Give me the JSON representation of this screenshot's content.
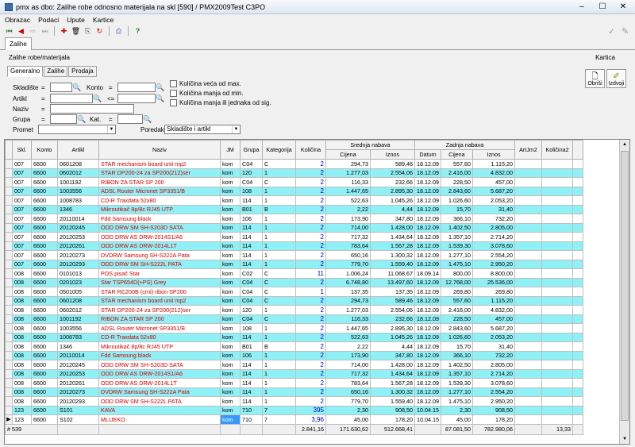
{
  "window": {
    "title": "pmx as dbo: Zalihe robe odnosno materijala na skl [590] / PMX2009Test C3PO",
    "minimize": "‒",
    "maximize": "☐",
    "close": "✕"
  },
  "menu": [
    "Obrazac",
    "Podaci",
    "Upute",
    "Kartice"
  ],
  "doc_tab": "Zalihe",
  "panel": {
    "title": "Zalihe robe/materijala",
    "kartica": "Kartica"
  },
  "subtabs": [
    "Generalno",
    "Zalihe",
    "Prodaja"
  ],
  "filters": {
    "skladiste": {
      "label": "Skladište",
      "op": "="
    },
    "konto": {
      "label": "Konto",
      "op": "="
    },
    "artikl": {
      "label": "Artikl",
      "op1": "=",
      "op2": "<="
    },
    "naziv": {
      "label": "Naziv",
      "op": "="
    },
    "grupa": {
      "label": "Grupa",
      "op": "="
    },
    "kat": {
      "label": "Kat.",
      "op": "="
    },
    "promet": {
      "label": "Promet",
      "value": ""
    },
    "poredak": {
      "label": "Poredak",
      "value": "Skladište i artikl"
    },
    "checks": [
      "Količina veća od max.",
      "Količina manja od min.",
      "Količina manja ili jednaka od sig."
    ],
    "obrisi": "Obriši",
    "izdvoji": "Izdvoji"
  },
  "grid": {
    "headers": {
      "skl": "Skl.",
      "konto": "Konto",
      "artikl": "Artikl",
      "naziv": "Naziv",
      "jm": "JM",
      "grupa": "Grupa",
      "kategorija": "Kategorija",
      "kolicina": "Količina",
      "srednja": "Srednja nabava",
      "cijena": "Cijena",
      "iznos": "Iznos",
      "zadnja": "Zadnja nabava",
      "datum": "Datum",
      "cijena2": "Cijena",
      "iznos2": "Iznos",
      "artjm2": "ArtJm2",
      "kolicina2": "Količina2"
    },
    "rows": [
      [
        "007",
        "6600",
        "0601208",
        "STAR mechanism board unit mp2",
        "kom",
        "C04",
        "C",
        "2",
        "294,73",
        "589,46",
        "18.12.09",
        "557,60",
        "1.115,20",
        "",
        ""
      ],
      [
        "007",
        "6600",
        "0602012",
        "STAR DP200-24 za SP200(212)ser",
        "kom",
        "120",
        "1",
        "2",
        "1.277,03",
        "2.554,06",
        "18.12.09",
        "2.416,00",
        "4.832,00",
        "",
        ""
      ],
      [
        "007",
        "6600",
        "1001192",
        "RIBON ZA STAR SP 200",
        "kom",
        "C04",
        "C",
        "2",
        "116,33",
        "232,66",
        "18.12.09",
        "228,50",
        "457,00",
        "",
        ""
      ],
      [
        "007",
        "6600",
        "1003556",
        "ADSL Router Micronet SP3351/B",
        "kom",
        "108",
        "1",
        "2",
        "1.447,65",
        "2.895,30",
        "18.12.09",
        "2.843,60",
        "5.687,20",
        "",
        ""
      ],
      [
        "007",
        "6600",
        "1008783",
        "CD-R Traxdata 52x80",
        "kom",
        "114",
        "1",
        "2",
        "522,63",
        "1.045,26",
        "18.12.09",
        "1.026,60",
        "2.053,20",
        "",
        ""
      ],
      [
        "007",
        "6600",
        "1346",
        "Mikroutikač 8p/8c RJ45 UTP",
        "kom",
        "B01",
        "B",
        "2",
        "2,22",
        "4,44",
        "18.12.09",
        "15,70",
        "31,40",
        "",
        ""
      ],
      [
        "007",
        "6600",
        "20110014",
        "Fdd Samsung black",
        "kom",
        "106",
        "1",
        "2",
        "173,90",
        "347,80",
        "18.12.09",
        "366,10",
        "732,20",
        "",
        ""
      ],
      [
        "007",
        "6600",
        "20120245",
        "ODD DRW SM SH-S203D SATA",
        "kom",
        "114",
        "1",
        "2",
        "714,00",
        "1.428,00",
        "18.12.09",
        "1.402,50",
        "2.805,00",
        "",
        ""
      ],
      [
        "007",
        "6600",
        "20120253",
        "ODD DRW AS DRW-2014S1/A6",
        "kom",
        "114",
        "1",
        "2",
        "717,32",
        "1.434,64",
        "18.12.09",
        "1.357,10",
        "2.714,20",
        "",
        ""
      ],
      [
        "007",
        "6600",
        "20120261",
        "ODD DRW AS DRW-2014L1T",
        "kom",
        "114",
        "1",
        "2",
        "783,64",
        "1.567,28",
        "18.12.09",
        "1.539,30",
        "3.078,60",
        "",
        ""
      ],
      [
        "007",
        "6600",
        "20120273",
        "DVDRW Samsung SH-S222A Pata",
        "kom",
        "114",
        "1",
        "2",
        "650,16",
        "1.300,32",
        "18.12.09",
        "1.277,10",
        "2.554,20",
        "",
        ""
      ],
      [
        "007",
        "6600",
        "20120293",
        "ODD DRW SM SH-S222L PATA",
        "kom",
        "114",
        "1",
        "2",
        "779,70",
        "1.559,40",
        "18.12.09",
        "1.475,10",
        "2.950,20",
        "",
        ""
      ],
      [
        "008",
        "6600",
        "0101013",
        "POS pisač Star",
        "kom",
        "C02",
        "C",
        "11",
        "1.006,24",
        "11.068,67",
        "18.09.14",
        "800,00",
        "8.800,00",
        "",
        ""
      ],
      [
        "008",
        "6600",
        "0201023",
        "Star TSP654D(+PS) Grey",
        "kom",
        "C04",
        "C",
        "2",
        "6.748,80",
        "13.497,60",
        "18.12.09",
        "12.768,00",
        "25.536,00",
        "",
        ""
      ],
      [
        "008",
        "6600",
        "0501005",
        "STAR RC200B (crni) ribon SP200",
        "kom",
        "C04",
        "C",
        "1",
        "137,35",
        "137,35",
        "18.12.09",
        "269,80",
        "269,80",
        "",
        ""
      ],
      [
        "008",
        "6600",
        "0601208",
        "STAR mechanism board unit mp2",
        "kom",
        "C04",
        "C",
        "2",
        "294,73",
        "589,46",
        "18.12.09",
        "557,60",
        "1.115,20",
        "",
        ""
      ],
      [
        "008",
        "6600",
        "0602012",
        "STAR DP200-24 za SP200(212)ser",
        "kom",
        "120",
        "1",
        "2",
        "1.277,03",
        "2.554,06",
        "18.12.09",
        "2.416,00",
        "4.832,00",
        "",
        ""
      ],
      [
        "008",
        "6600",
        "1001192",
        "RIBON ZA STAR SP 200",
        "kom",
        "C04",
        "C",
        "2",
        "116,33",
        "232,66",
        "18.12.09",
        "228,50",
        "457,00",
        "",
        ""
      ],
      [
        "008",
        "6600",
        "1003556",
        "ADSL Router Micronet SP3351/B",
        "kom",
        "108",
        "1",
        "2",
        "1.447,65",
        "2.895,30",
        "18.12.09",
        "2.843,60",
        "5.687,20",
        "",
        ""
      ],
      [
        "008",
        "6600",
        "1008783",
        "CD-R Traxdata 52x80",
        "kom",
        "114",
        "1",
        "2",
        "522,63",
        "1.045,26",
        "18.12.09",
        "1.026,60",
        "2.053,20",
        "",
        ""
      ],
      [
        "008",
        "6600",
        "1346",
        "Mikroutikač 8p/8c RJ45 UTP",
        "kom",
        "B01",
        "B",
        "2",
        "2,22",
        "4,44",
        "18.12.09",
        "15,70",
        "31,40",
        "",
        ""
      ],
      [
        "008",
        "6600",
        "20110014",
        "Fdd Samsung black",
        "kom",
        "106",
        "1",
        "2",
        "173,90",
        "347,80",
        "18.12.09",
        "366,10",
        "732,20",
        "",
        ""
      ],
      [
        "008",
        "6600",
        "20120245",
        "ODD DRW SM SH-S203D SATA",
        "kom",
        "114",
        "1",
        "2",
        "714,00",
        "1.428,00",
        "18.12.09",
        "1.402,50",
        "2.805,00",
        "",
        ""
      ],
      [
        "008",
        "6600",
        "20120253",
        "ODD DRW AS DRW-2014S1/A6",
        "kom",
        "114",
        "1",
        "2",
        "717,32",
        "1.434,64",
        "18.12.09",
        "1.357,10",
        "2.714,20",
        "",
        ""
      ],
      [
        "008",
        "6600",
        "20120261",
        "ODD DRW AS DRW-2014L1T",
        "kom",
        "114",
        "1",
        "2",
        "783,64",
        "1.567,28",
        "18.12.09",
        "1.539,30",
        "3.078,60",
        "",
        ""
      ],
      [
        "008",
        "6600",
        "20120273",
        "DVDRW Samsung SH-S222A Pata",
        "kom",
        "114",
        "1",
        "2",
        "650,16",
        "1.300,32",
        "18.12.09",
        "1.277,10",
        "2.554,20",
        "",
        ""
      ],
      [
        "008",
        "6600",
        "20120293",
        "ODD DRW SM SH-S222L PATA",
        "kom",
        "114",
        "1",
        "2",
        "779,70",
        "1.559,40",
        "18.12.09",
        "1.475,10",
        "2.950,20",
        "",
        ""
      ],
      [
        "123",
        "6600",
        "S101",
        "KAVA",
        "kom",
        "710",
        "7",
        "395",
        "2,30",
        "908,50",
        "10.04.15",
        "2,30",
        "908,50",
        "",
        ""
      ],
      [
        "123",
        "6600",
        "S102",
        "MLIJEKO",
        "kom",
        "710",
        "7",
        "3,96",
        "45,00",
        "178,20",
        "10.04.15",
        "45,00",
        "178,20",
        "",
        ""
      ]
    ],
    "footer": {
      "count": "# 539",
      "kolicina": "2.841,16",
      "cijena": "171.630,62",
      "iznos": "512.668,41",
      "cijena2": "87.081,50",
      "iznos2": "782.980,06",
      "kolicina2": "13,33"
    }
  },
  "colors": {
    "cyan_row": "#8ff0f6",
    "name_red": "#d00000",
    "qty_blue": "#0000c0",
    "selection": "#3399ff"
  }
}
